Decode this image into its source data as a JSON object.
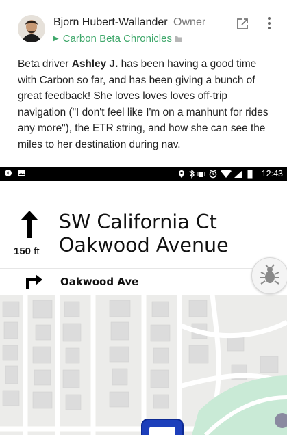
{
  "post": {
    "author_name": "Bjorn Hubert-Wallander",
    "author_role": "Owner",
    "community": "Carbon Beta Chronicles",
    "body_intro": "Beta driver ",
    "body_highlight": "Ashley J.",
    "body_rest": " has been having a good time with Carbon so far, and has been giving a bunch of great feedback!  She loves loves loves off-trip navigation (\"I don't feel like I'm on a manhunt for rides any more\"), the ETR string, and how she can see the miles to her destination during nav."
  },
  "status_bar": {
    "time": "12:43"
  },
  "navigation": {
    "primary_street": "SW California Ct",
    "secondary_street": "Oakwood Avenue",
    "distance_value": "150",
    "distance_unit": "ft",
    "next_turn_street": "Oakwood Ave"
  },
  "colors": {
    "community_green": "#3ea76a",
    "map_background": "#ececea",
    "map_park": "#c9ead6",
    "vehicle_blue": "#1d3fbb"
  },
  "icons": {
    "maneuver": "arrow-up-icon",
    "next_turn": "turn-right-icon",
    "report": "bug-icon",
    "open": "open-external-icon",
    "menu": "more-vert-icon"
  }
}
